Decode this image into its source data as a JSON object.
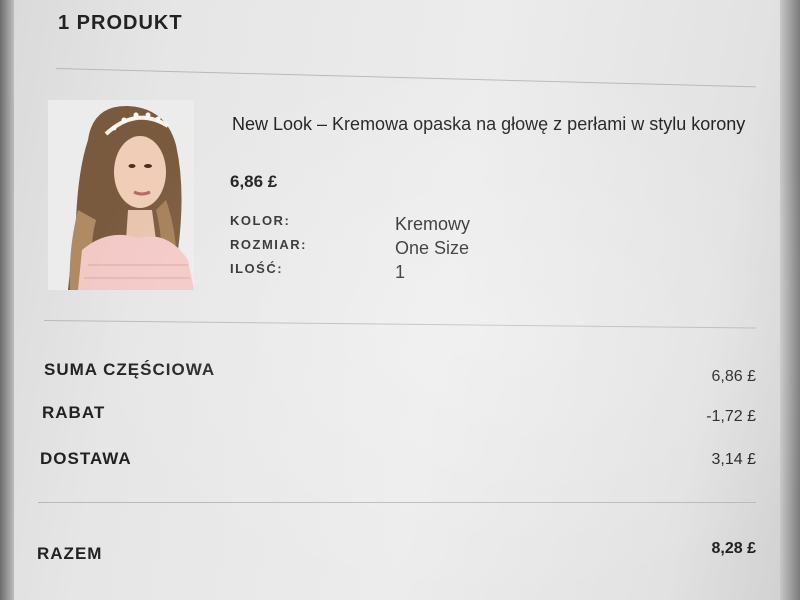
{
  "cart": {
    "section_title": "1 PRODUKT"
  },
  "product": {
    "name": "New Look – Kremowa opaska na głowę z perłami w stylu korony",
    "price": "6,86 £",
    "attributes": [
      {
        "label": "KOLOR:",
        "value": "Kremowy"
      },
      {
        "label": "ROZMIAR:",
        "value": "One Size"
      },
      {
        "label": "ILOŚĆ:",
        "value": "1"
      }
    ]
  },
  "summary": {
    "rows": [
      {
        "label": "SUMA CZĘŚCIOWA",
        "value": "6,86 £"
      },
      {
        "label": "RABAT",
        "value": "-1,72 £"
      },
      {
        "label": "DOSTAWA",
        "value": "3,14 £"
      }
    ],
    "total_label": "RAZEM",
    "total_value": "8,28 £"
  }
}
